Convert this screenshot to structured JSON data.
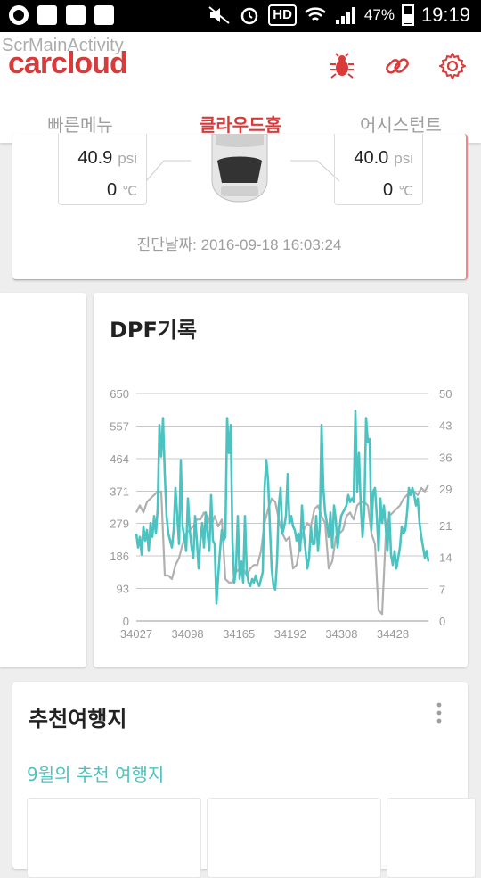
{
  "status_bar": {
    "hd_label": "HD",
    "battery_pct": "47%",
    "battery_level": 0.47,
    "time": "19:19"
  },
  "app": {
    "debug_activity_name": "ScrMainActivity",
    "logo_text": "carcloud",
    "accent_color": "#d93a3a",
    "teal_color": "#4cc3c0"
  },
  "toolbar_icons": [
    "bug-icon",
    "link-icon",
    "gear-icon"
  ],
  "tabs": [
    {
      "label": "빠른메뉴",
      "active": false
    },
    {
      "label": "클라우드홈",
      "active": true
    },
    {
      "label": "어시스턴트",
      "active": false
    }
  ],
  "tire_card": {
    "left_tire": {
      "pressure": "40.9",
      "pressure_unit": "psi",
      "temp": "0",
      "temp_unit": "℃"
    },
    "right_tire": {
      "pressure": "40.0",
      "pressure_unit": "psi",
      "temp": "0",
      "temp_unit": "℃"
    },
    "diagnosis_text": "진단날짜: 2016-09-18 16:03:24"
  },
  "dpf_card": {
    "title": "DPF기록"
  },
  "chart_data": {
    "type": "line",
    "title": "DPF기록",
    "x_tick_labels": [
      "34027",
      "34098",
      "34165",
      "34192",
      "34308",
      "34428"
    ],
    "y_left_ticks": [
      650,
      557,
      464,
      371,
      279,
      186,
      93,
      0
    ],
    "y_right_ticks": [
      50,
      43,
      36,
      29,
      21,
      14,
      7,
      0
    ],
    "ylim_left": [
      0,
      650
    ],
    "ylim_right": [
      0,
      50
    ],
    "grid": true,
    "series": [
      {
        "axis": "left",
        "color": "#4cc3c0",
        "x": [
          0,
          2,
          4,
          6,
          8,
          10,
          12,
          14,
          16,
          18,
          20,
          22,
          24,
          26,
          28,
          30,
          32,
          34,
          36,
          38,
          40,
          42,
          44,
          46,
          48,
          50,
          52,
          54,
          56,
          58,
          60,
          62,
          64,
          66,
          68,
          70,
          72,
          74,
          76,
          78,
          80,
          82,
          84,
          86,
          88,
          90,
          92,
          94,
          96,
          98,
          100,
          102,
          104,
          106,
          108,
          110,
          112,
          114,
          116,
          118,
          120,
          122,
          124,
          126,
          128,
          130,
          132,
          134,
          136,
          138,
          140,
          142,
          144,
          146,
          148,
          150,
          152,
          154,
          156,
          158,
          160,
          162,
          164,
          166,
          168,
          170,
          172,
          174,
          176,
          178,
          180,
          182,
          184,
          186,
          188,
          190,
          192,
          194,
          196,
          198,
          200,
          202,
          204,
          206,
          208,
          210,
          212,
          214,
          216,
          218,
          220,
          222,
          224,
          226,
          228,
          230,
          232,
          234,
          236,
          238,
          240,
          242,
          244,
          246,
          248,
          250,
          252,
          254,
          256,
          258,
          260,
          262,
          264,
          266,
          268,
          270,
          272,
          274,
          276,
          278,
          280,
          282,
          284,
          286,
          288,
          290,
          292,
          294,
          296,
          298,
          300,
          302,
          304,
          306,
          308,
          310,
          312,
          314,
          316,
          318,
          320,
          322,
          324,
          326,
          328
        ],
        "y": [
          250,
          210,
          240,
          190,
          270,
          230,
          260,
          200,
          280,
          240,
          300,
          250,
          320,
          560,
          470,
          580,
          420,
          300,
          250,
          230,
          210,
          260,
          380,
          300,
          220,
          460,
          270,
          240,
          200,
          350,
          260,
          210,
          180,
          300,
          230,
          150,
          230,
          280,
          210,
          310,
          250,
          200,
          360,
          230,
          220,
          50,
          130,
          200,
          260,
          230,
          240,
          580,
          480,
          560,
          230,
          110,
          150,
          300,
          120,
          170,
          110,
          300,
          140,
          110,
          100,
          120,
          110,
          130,
          110,
          100,
          120,
          140,
          380,
          460,
          400,
          270,
          150,
          100,
          90,
          170,
          330,
          380,
          250,
          270,
          300,
          420,
          280,
          300,
          270,
          260,
          230,
          250,
          200,
          330,
          250,
          200,
          150,
          180,
          270,
          220,
          220,
          300,
          200,
          270,
          560,
          380,
          310,
          280,
          240,
          310,
          210,
          330,
          290,
          210,
          260,
          300,
          310,
          320,
          330,
          360,
          340,
          350,
          340,
          600,
          370,
          480,
          330,
          240,
          320,
          580,
          510,
          520,
          260,
          370,
          380,
          300,
          200,
          350,
          280,
          330,
          270,
          200,
          310,
          190,
          160,
          200,
          150,
          180,
          210,
          270,
          250,
          260,
          310,
          380,
          360,
          380,
          360,
          330,
          350,
          280,
          240,
          210,
          180,
          200,
          170
        ],
        "name": ""
      },
      {
        "axis": "left",
        "color": "#b0b0b0",
        "x": [
          0,
          4,
          8,
          12,
          16,
          20,
          24,
          28,
          32,
          36,
          40,
          44,
          48,
          52,
          56,
          60,
          64,
          68,
          72,
          76,
          80,
          84,
          88,
          92,
          96,
          100,
          104,
          108,
          112,
          116,
          120,
          124,
          128,
          132,
          136,
          140,
          144,
          148,
          152,
          156,
          160,
          164,
          168,
          172,
          176,
          180,
          184,
          188,
          192,
          196,
          200,
          204,
          208,
          212,
          216,
          220,
          224,
          228,
          232,
          236,
          240,
          244,
          248,
          252,
          256,
          260,
          264,
          268,
          272,
          276,
          280,
          284,
          288,
          292,
          296,
          300,
          304,
          308,
          312,
          316,
          320,
          324,
          328
        ],
        "y": [
          310,
          330,
          310,
          340,
          350,
          360,
          370,
          370,
          130,
          130,
          120,
          160,
          180,
          220,
          250,
          260,
          270,
          290,
          290,
          310,
          300,
          270,
          300,
          270,
          290,
          120,
          110,
          110,
          140,
          150,
          150,
          130,
          150,
          160,
          160,
          200,
          280,
          320,
          350,
          340,
          290,
          250,
          230,
          240,
          150,
          160,
          220,
          260,
          280,
          270,
          320,
          330,
          300,
          280,
          150,
          170,
          240,
          250,
          260,
          300,
          310,
          290,
          330,
          340,
          340,
          330,
          250,
          220,
          30,
          20,
          240,
          300,
          310,
          320,
          330,
          350,
          360,
          370,
          370,
          360,
          380,
          370,
          390
        ]
      }
    ]
  },
  "trip_card": {
    "title": "추천여행지",
    "subtitle": "9월의 추천 여행지"
  }
}
